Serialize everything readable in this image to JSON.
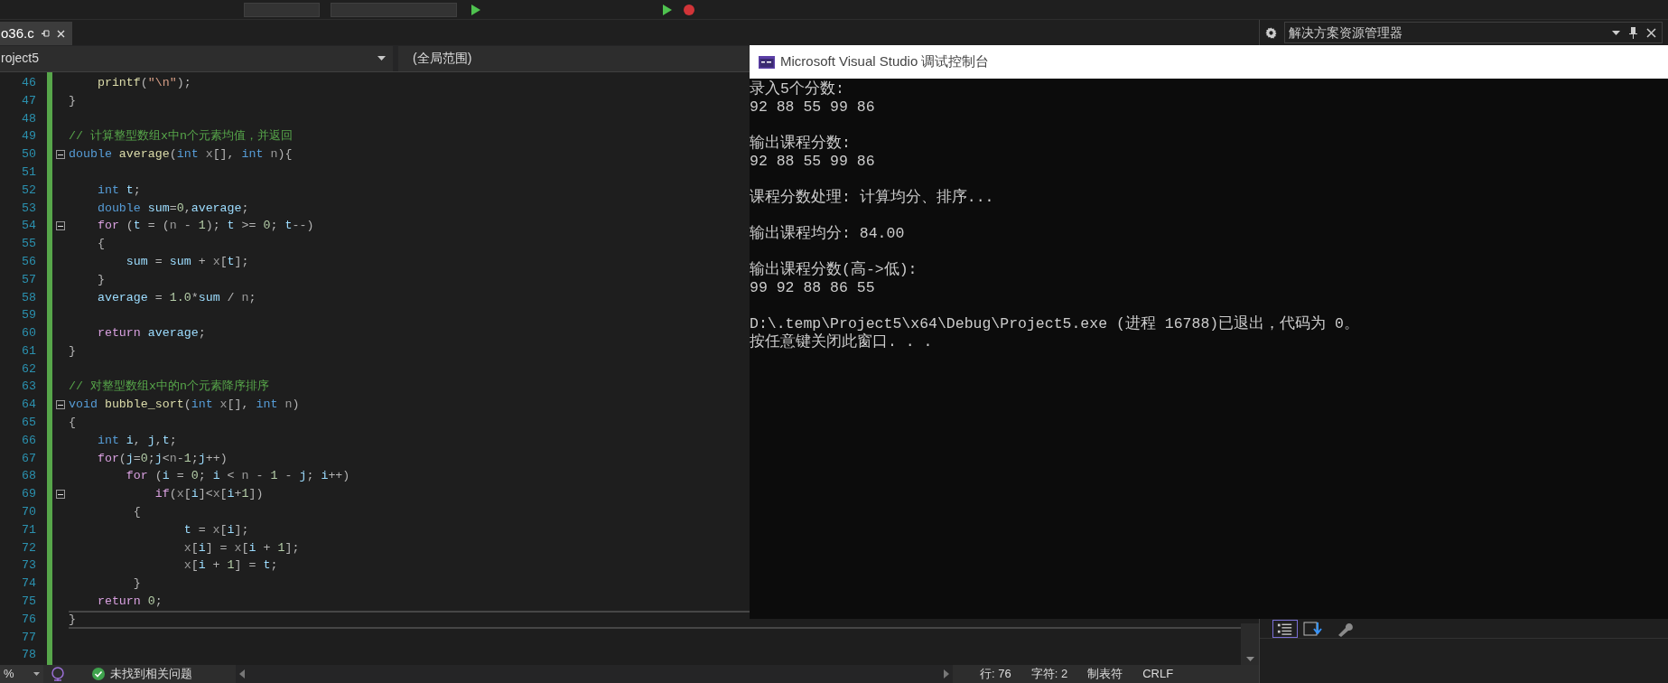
{
  "editor": {
    "tab": {
      "label": "o36.c",
      "selected": true
    },
    "nav": {
      "project": "roject5",
      "scope": "(全局范围)"
    },
    "lines": [
      {
        "number": "46",
        "fold": false,
        "current": false,
        "tokens": [
          {
            "kind": "fn",
            "text": "    printf"
          },
          {
            "kind": "p",
            "text": "("
          },
          {
            "kind": "str",
            "text": "\"\\n\""
          },
          {
            "kind": "p",
            "text": ");"
          }
        ]
      },
      {
        "number": "47",
        "fold": false,
        "current": false,
        "tokens": [
          {
            "kind": "p",
            "text": "}"
          }
        ]
      },
      {
        "number": "48",
        "fold": false,
        "current": false
      },
      {
        "number": "49",
        "fold": false,
        "current": false,
        "tokens": [
          {
            "kind": "cmt",
            "text": "// 计算整型数组x中n个元素均值，并返回"
          }
        ]
      },
      {
        "number": "50",
        "fold": true,
        "current": false,
        "tokens": [
          {
            "kind": "kw",
            "text": "double"
          },
          {
            "kind": "fn",
            "text": " average"
          },
          {
            "kind": "p",
            "text": "("
          },
          {
            "kind": "kw",
            "text": "int"
          },
          {
            "kind": "par",
            "text": " x"
          },
          {
            "kind": "p",
            "text": "[], "
          },
          {
            "kind": "kw",
            "text": "int"
          },
          {
            "kind": "par",
            "text": " n"
          },
          {
            "kind": "p",
            "text": "){"
          }
        ]
      },
      {
        "number": "51",
        "fold": false,
        "current": false
      },
      {
        "number": "52",
        "fold": false,
        "current": false,
        "tokens": [
          {
            "kind": "kw",
            "text": "    int"
          },
          {
            "kind": "var",
            "text": " t"
          },
          {
            "kind": "p",
            "text": ";"
          }
        ]
      },
      {
        "number": "53",
        "fold": false,
        "current": false,
        "tokens": [
          {
            "kind": "kw",
            "text": "    double"
          },
          {
            "kind": "var",
            "text": " sum"
          },
          {
            "kind": "p",
            "text": "="
          },
          {
            "kind": "num",
            "text": "0"
          },
          {
            "kind": "p",
            "text": ","
          },
          {
            "kind": "var",
            "text": "average"
          },
          {
            "kind": "p",
            "text": ";"
          }
        ]
      },
      {
        "number": "54",
        "fold": true,
        "current": false,
        "tokens": [
          {
            "kind": "ctl",
            "text": "    for"
          },
          {
            "kind": "p",
            "text": " ("
          },
          {
            "kind": "var",
            "text": "t"
          },
          {
            "kind": "p",
            "text": " = ("
          },
          {
            "kind": "par",
            "text": "n"
          },
          {
            "kind": "p",
            "text": " - "
          },
          {
            "kind": "num",
            "text": "1"
          },
          {
            "kind": "p",
            "text": "); "
          },
          {
            "kind": "var",
            "text": "t"
          },
          {
            "kind": "p",
            "text": " >= "
          },
          {
            "kind": "num",
            "text": "0"
          },
          {
            "kind": "p",
            "text": "; "
          },
          {
            "kind": "var",
            "text": "t"
          },
          {
            "kind": "p",
            "text": "--)"
          }
        ]
      },
      {
        "number": "55",
        "fold": false,
        "current": false,
        "tokens": [
          {
            "kind": "p",
            "text": "    {"
          }
        ]
      },
      {
        "number": "56",
        "fold": false,
        "current": false,
        "tokens": [
          {
            "kind": "var",
            "text": "        sum"
          },
          {
            "kind": "p",
            "text": " = "
          },
          {
            "kind": "var",
            "text": "sum"
          },
          {
            "kind": "p",
            "text": " + "
          },
          {
            "kind": "par",
            "text": "x"
          },
          {
            "kind": "p",
            "text": "["
          },
          {
            "kind": "var",
            "text": "t"
          },
          {
            "kind": "p",
            "text": "];"
          }
        ]
      },
      {
        "number": "57",
        "fold": false,
        "current": false,
        "tokens": [
          {
            "kind": "p",
            "text": "    }"
          }
        ]
      },
      {
        "number": "58",
        "fold": false,
        "current": false,
        "tokens": [
          {
            "kind": "var",
            "text": "    average"
          },
          {
            "kind": "p",
            "text": " = "
          },
          {
            "kind": "num",
            "text": "1.0"
          },
          {
            "kind": "p",
            "text": "*"
          },
          {
            "kind": "var",
            "text": "sum"
          },
          {
            "kind": "p",
            "text": " / "
          },
          {
            "kind": "par",
            "text": "n"
          },
          {
            "kind": "p",
            "text": ";"
          }
        ]
      },
      {
        "number": "59",
        "fold": false,
        "current": false
      },
      {
        "number": "60",
        "fold": false,
        "current": false,
        "tokens": [
          {
            "kind": "ctl",
            "text": "    return"
          },
          {
            "kind": "var",
            "text": " average"
          },
          {
            "kind": "p",
            "text": ";"
          }
        ]
      },
      {
        "number": "61",
        "fold": false,
        "current": false,
        "tokens": [
          {
            "kind": "p",
            "text": "}"
          }
        ]
      },
      {
        "number": "62",
        "fold": false,
        "current": false
      },
      {
        "number": "63",
        "fold": false,
        "current": false,
        "tokens": [
          {
            "kind": "cmt",
            "text": "// 对整型数组x中的n个元素降序排序"
          }
        ]
      },
      {
        "number": "64",
        "fold": true,
        "current": false,
        "tokens": [
          {
            "kind": "kw",
            "text": "void"
          },
          {
            "kind": "fn",
            "text": " bubble_sort"
          },
          {
            "kind": "p",
            "text": "("
          },
          {
            "kind": "kw",
            "text": "int"
          },
          {
            "kind": "par",
            "text": " x"
          },
          {
            "kind": "p",
            "text": "[], "
          },
          {
            "kind": "kw",
            "text": "int"
          },
          {
            "kind": "par",
            "text": " n"
          },
          {
            "kind": "p",
            "text": ")"
          }
        ]
      },
      {
        "number": "65",
        "fold": false,
        "current": false,
        "tokens": [
          {
            "kind": "p",
            "text": "{"
          }
        ]
      },
      {
        "number": "66",
        "fold": false,
        "current": false,
        "tokens": [
          {
            "kind": "kw",
            "text": "    int"
          },
          {
            "kind": "var",
            "text": " i"
          },
          {
            "kind": "p",
            "text": ", "
          },
          {
            "kind": "var",
            "text": "j"
          },
          {
            "kind": "p",
            "text": ","
          },
          {
            "kind": "var",
            "text": "t"
          },
          {
            "kind": "p",
            "text": ";"
          }
        ]
      },
      {
        "number": "67",
        "fold": false,
        "current": false,
        "tokens": [
          {
            "kind": "ctl",
            "text": "    for"
          },
          {
            "kind": "p",
            "text": "("
          },
          {
            "kind": "var",
            "text": "j"
          },
          {
            "kind": "p",
            "text": "="
          },
          {
            "kind": "num",
            "text": "0"
          },
          {
            "kind": "p",
            "text": ";"
          },
          {
            "kind": "var",
            "text": "j"
          },
          {
            "kind": "p",
            "text": "<"
          },
          {
            "kind": "par",
            "text": "n"
          },
          {
            "kind": "p",
            "text": "-"
          },
          {
            "kind": "num",
            "text": "1"
          },
          {
            "kind": "p",
            "text": ";"
          },
          {
            "kind": "var",
            "text": "j"
          },
          {
            "kind": "p",
            "text": "++)"
          }
        ]
      },
      {
        "number": "68",
        "fold": false,
        "current": false,
        "tokens": [
          {
            "kind": "ctl",
            "text": "        for"
          },
          {
            "kind": "p",
            "text": " ("
          },
          {
            "kind": "var",
            "text": "i"
          },
          {
            "kind": "p",
            "text": " = "
          },
          {
            "kind": "num",
            "text": "0"
          },
          {
            "kind": "p",
            "text": "; "
          },
          {
            "kind": "var",
            "text": "i"
          },
          {
            "kind": "p",
            "text": " < "
          },
          {
            "kind": "par",
            "text": "n"
          },
          {
            "kind": "p",
            "text": " - "
          },
          {
            "kind": "num",
            "text": "1"
          },
          {
            "kind": "p",
            "text": " - "
          },
          {
            "kind": "var",
            "text": "j"
          },
          {
            "kind": "p",
            "text": "; "
          },
          {
            "kind": "var",
            "text": "i"
          },
          {
            "kind": "p",
            "text": "++)"
          }
        ]
      },
      {
        "number": "69",
        "fold": true,
        "current": false,
        "tokens": [
          {
            "kind": "ctl",
            "text": "            if"
          },
          {
            "kind": "p",
            "text": "("
          },
          {
            "kind": "par",
            "text": "x"
          },
          {
            "kind": "p",
            "text": "["
          },
          {
            "kind": "var",
            "text": "i"
          },
          {
            "kind": "p",
            "text": "]<"
          },
          {
            "kind": "par",
            "text": "x"
          },
          {
            "kind": "p",
            "text": "["
          },
          {
            "kind": "var",
            "text": "i"
          },
          {
            "kind": "p",
            "text": "+"
          },
          {
            "kind": "num",
            "text": "1"
          },
          {
            "kind": "p",
            "text": "])"
          }
        ]
      },
      {
        "number": "70",
        "fold": false,
        "current": false,
        "tokens": [
          {
            "kind": "p",
            "text": "         {"
          }
        ]
      },
      {
        "number": "71",
        "fold": false,
        "current": false,
        "tokens": [
          {
            "kind": "var",
            "text": "                t"
          },
          {
            "kind": "p",
            "text": " = "
          },
          {
            "kind": "par",
            "text": "x"
          },
          {
            "kind": "p",
            "text": "["
          },
          {
            "kind": "var",
            "text": "i"
          },
          {
            "kind": "p",
            "text": "];"
          }
        ]
      },
      {
        "number": "72",
        "fold": false,
        "current": false,
        "tokens": [
          {
            "kind": "par",
            "text": "                x"
          },
          {
            "kind": "p",
            "text": "["
          },
          {
            "kind": "var",
            "text": "i"
          },
          {
            "kind": "p",
            "text": "] = "
          },
          {
            "kind": "par",
            "text": "x"
          },
          {
            "kind": "p",
            "text": "["
          },
          {
            "kind": "var",
            "text": "i"
          },
          {
            "kind": "p",
            "text": " + "
          },
          {
            "kind": "num",
            "text": "1"
          },
          {
            "kind": "p",
            "text": "];"
          }
        ]
      },
      {
        "number": "73",
        "fold": false,
        "current": false,
        "tokens": [
          {
            "kind": "par",
            "text": "                x"
          },
          {
            "kind": "p",
            "text": "["
          },
          {
            "kind": "var",
            "text": "i"
          },
          {
            "kind": "p",
            "text": " + "
          },
          {
            "kind": "num",
            "text": "1"
          },
          {
            "kind": "p",
            "text": "] = "
          },
          {
            "kind": "var",
            "text": "t"
          },
          {
            "kind": "p",
            "text": ";"
          }
        ]
      },
      {
        "number": "74",
        "fold": false,
        "current": false,
        "tokens": [
          {
            "kind": "p",
            "text": "         }"
          }
        ]
      },
      {
        "number": "75",
        "fold": false,
        "current": false,
        "tokens": [
          {
            "kind": "ctl",
            "text": "    return"
          },
          {
            "kind": "num",
            "text": " 0"
          },
          {
            "kind": "p",
            "text": ";"
          }
        ]
      },
      {
        "number": "76",
        "fold": false,
        "current": true,
        "tokens": [
          {
            "kind": "p",
            "text": "}"
          }
        ]
      },
      {
        "number": "77",
        "fold": false,
        "current": false
      },
      {
        "number": "78",
        "fold": false,
        "current": false
      }
    ],
    "status": {
      "zoom": "%",
      "issues": "未找到相关问题",
      "line": "行: 76",
      "char": "字符: 2",
      "indent": "制表符",
      "eol": "CRLF"
    }
  },
  "solution_explorer": {
    "title": "解决方案资源管理器"
  },
  "console": {
    "title": "Microsoft Visual Studio 调试控制台",
    "blocks": [
      [
        "录入5个分数:",
        "92 88 55 99 86"
      ],
      [
        "输出课程分数:",
        "92 88 55 99 86"
      ],
      [
        "课程分数处理: 计算均分、排序..."
      ],
      [
        "输出课程均分: 84.00"
      ],
      [
        "输出课程分数(高->低):",
        "99 92 88 86 55"
      ],
      [
        "D:\\.temp\\Project5\\x64\\Debug\\Project5.exe (进程 16788)已退出，代码为 0。",
        "按任意键关闭此窗口. . ."
      ]
    ]
  }
}
